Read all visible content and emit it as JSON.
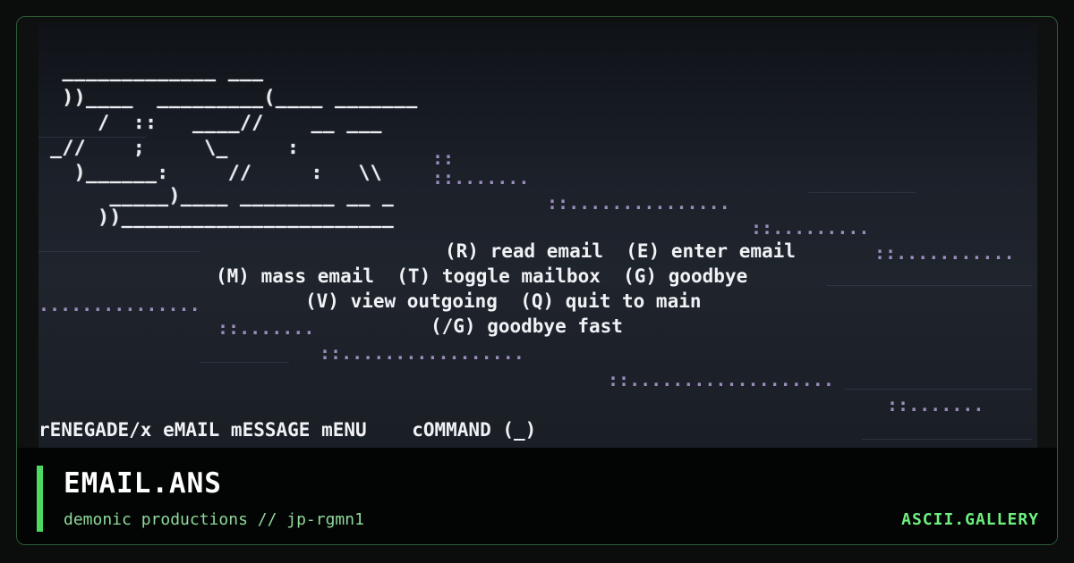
{
  "art": {
    "logo_lines": [
      "  _____________ ___",
      "  ))____  _________(____ _______",
      "     /  ::   ____//    __ ___",
      " _//    ;     \\_     :",
      "   )______:     //     :   \\\\",
      "      _____)____ ________ __ _",
      "     ))_______________________"
    ],
    "dot_rows": [
      "::",
      "::.......",
      "::...............",
      "::.........",
      "::...........",
      "...............",
      "::.......",
      "::.................",
      "::...................",
      "::......."
    ]
  },
  "menu": {
    "line1": "(R) read email  (E) enter email",
    "line2": "(M) mass email  (T) toggle mailbox  (G) goodbye",
    "line3": "(V) view outgoing  (Q) quit to main",
    "line4": "(/G) goodbye fast"
  },
  "status": {
    "text": "rENEGADE/x eMAIL mESSAGE mENU    cOMMAND (_)"
  },
  "caption": {
    "title": "EMAIL.ANS",
    "subtitle": "demonic productions // jp-rgmn1",
    "brand": "ASCII.GALLERY"
  },
  "colors": {
    "accent": "#4cd964",
    "brand": "#6ef07e",
    "dots": "#b9a8e0",
    "text": "#f0f2f5"
  }
}
